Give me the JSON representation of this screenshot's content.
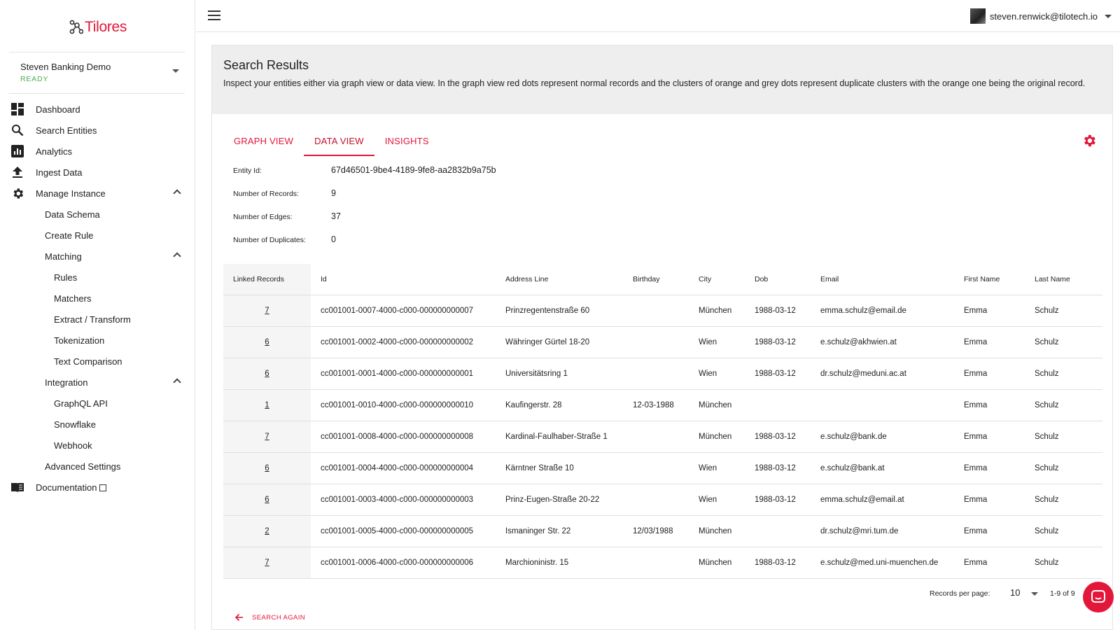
{
  "brand": {
    "name": "Tilores",
    "color": "#e3173a"
  },
  "instance": {
    "name": "Steven Banking Demo",
    "status": "READY"
  },
  "nav": {
    "dashboard": "Dashboard",
    "search_entities": "Search Entities",
    "analytics": "Analytics",
    "ingest_data": "Ingest Data",
    "manage_instance": "Manage Instance",
    "data_schema": "Data Schema",
    "create_rule": "Create Rule",
    "matching": "Matching",
    "rules": "Rules",
    "matchers": "Matchers",
    "extract_transform": "Extract / Transform",
    "tokenization": "Tokenization",
    "text_comparison": "Text Comparison",
    "integration": "Integration",
    "graphql_api": "GraphQL API",
    "snowflake": "Snowflake",
    "webhook": "Webhook",
    "advanced_settings": "Advanced Settings",
    "documentation": "Documentation"
  },
  "user": {
    "email": "steven.renwick@tilotech.io"
  },
  "page": {
    "title": "Search Results",
    "description": "Inspect your entities either via graph view or data view. In the graph view red dots represent normal records and the clusters of orange and grey dots represent duplicate clusters with the orange one being the original record."
  },
  "tabs": {
    "graph_view": "GRAPH VIEW",
    "data_view": "DATA VIEW",
    "insights": "INSIGHTS"
  },
  "entity": {
    "entity_id_label": "Entity Id:",
    "entity_id": "67d46501-9be4-4189-9fe8-aa2832b9a75b",
    "num_records_label": "Number of Records:",
    "num_records": "9",
    "num_edges_label": "Number of Edges:",
    "num_edges": "37",
    "num_duplicates_label": "Number of Duplicates:",
    "num_duplicates": "0"
  },
  "table": {
    "headers": [
      "Linked Records",
      "Id",
      "Address Line",
      "Birthday",
      "City",
      "Dob",
      "Email",
      "First Name",
      "Last Name"
    ],
    "rows": [
      [
        "7",
        "cc001001-0007-4000-c000-000000000007",
        "Prinzregentenstraße 60",
        "",
        "München",
        "1988-03-12",
        "emma.schulz@email.de",
        "Emma",
        "Schulz"
      ],
      [
        "6",
        "cc001001-0002-4000-c000-000000000002",
        "Währinger Gürtel 18-20",
        "",
        "Wien",
        "1988-03-12",
        "e.schulz@akhwien.at",
        "Emma",
        "Schulz"
      ],
      [
        "6",
        "cc001001-0001-4000-c000-000000000001",
        "Universitätsring 1",
        "",
        "Wien",
        "1988-03-12",
        "dr.schulz@meduni.ac.at",
        "Emma",
        "Schulz"
      ],
      [
        "1",
        "cc001001-0010-4000-c000-000000000010",
        "Kaufingerstr. 28",
        "12-03-1988",
        "München",
        "",
        "",
        "Emma",
        "Schulz"
      ],
      [
        "7",
        "cc001001-0008-4000-c000-000000000008",
        "Kardinal-Faulhaber-Straße 1",
        "",
        "München",
        "1988-03-12",
        "e.schulz@bank.de",
        "Emma",
        "Schulz"
      ],
      [
        "6",
        "cc001001-0004-4000-c000-000000000004",
        "Kärntner Straße 10",
        "",
        "Wien",
        "1988-03-12",
        "e.schulz@bank.at",
        "Emma",
        "Schulz"
      ],
      [
        "6",
        "cc001001-0003-4000-c000-000000000003",
        "Prinz-Eugen-Straße 20-22",
        "",
        "Wien",
        "1988-03-12",
        "emma.schulz@email.at",
        "Emma",
        "Schulz"
      ],
      [
        "2",
        "cc001001-0005-4000-c000-000000000005",
        "Ismaninger Str. 22",
        "12/03/1988",
        "München",
        "",
        "dr.schulz@mri.tum.de",
        "Emma",
        "Schulz"
      ],
      [
        "7",
        "cc001001-0006-4000-c000-000000000006",
        "Marchioninistr. 15",
        "",
        "München",
        "1988-03-12",
        "e.schulz@med.uni-muenchen.de",
        "Emma",
        "Schulz"
      ]
    ]
  },
  "pagination": {
    "records_per_page_label": "Records per page:",
    "records_per_page": "10",
    "range": "1-9 of 9"
  },
  "search_again": "SEARCH AGAIN"
}
